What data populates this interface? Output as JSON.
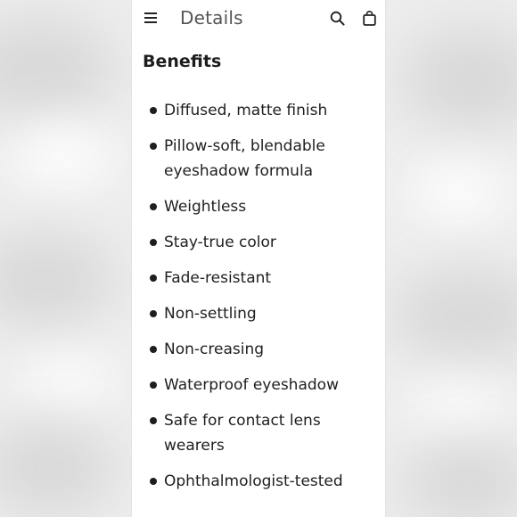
{
  "header": {
    "title": "Details",
    "icons": {
      "menu": "hamburger-menu-icon",
      "search": "search-icon",
      "bag": "shopping-bag-icon"
    }
  },
  "benefits": {
    "title": "Benefits",
    "items": [
      "Diffused, matte finish",
      "Pillow-soft, blendable eyeshadow formula",
      "Weightless",
      "Stay-true color",
      "Fade-resistant",
      "Non-settling",
      "Non-creasing",
      "Waterproof eyeshadow",
      "Safe for contact lens wearers",
      "Ophthalmologist-tested"
    ]
  },
  "colors": {
    "text": "#1e1e1e",
    "header_text": "#555555",
    "background": "#ededed",
    "panel": "#ffffff"
  }
}
